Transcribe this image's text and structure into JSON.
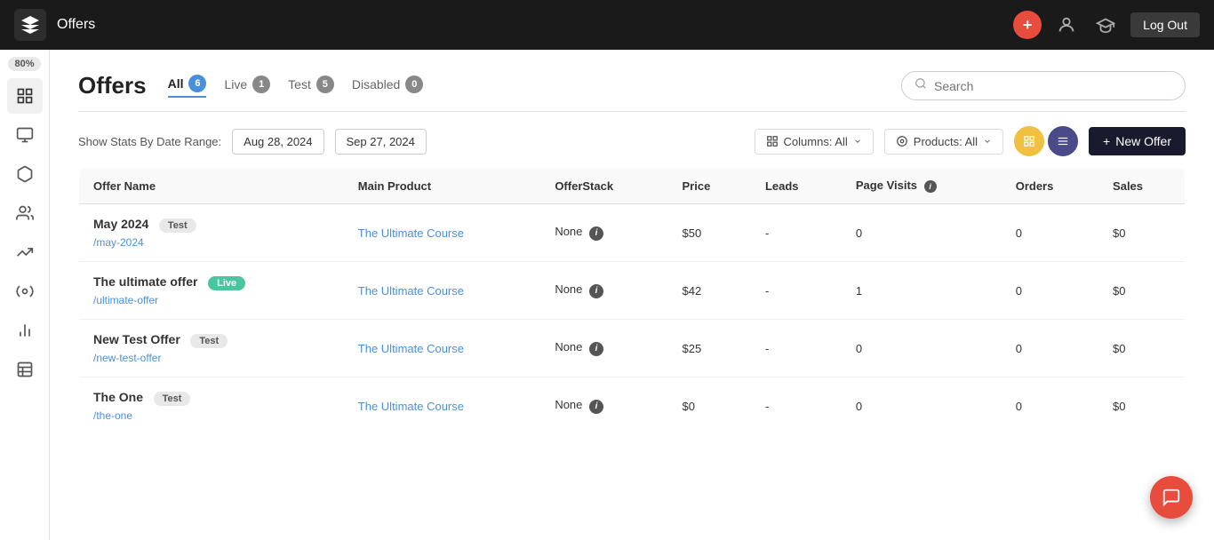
{
  "topnav": {
    "title": "Offers",
    "logout_label": "Log Out",
    "plus_icon": "+",
    "user_icon": "👤",
    "grad_icon": "🎓"
  },
  "sidebar_badge": "80%",
  "tabs": {
    "all": {
      "label": "All",
      "count": "6"
    },
    "live": {
      "label": "Live",
      "count": "1"
    },
    "test": {
      "label": "Test",
      "count": "5"
    },
    "disabled": {
      "label": "Disabled",
      "count": "0"
    }
  },
  "search": {
    "placeholder": "Search"
  },
  "toolbar": {
    "stats_label": "Show Stats By Date Range:",
    "date_start": "Aug 28, 2024",
    "date_end": "Sep 27, 2024",
    "columns_label": "Columns: All",
    "products_label": "Products: All",
    "new_offer_label": "New Offer"
  },
  "table": {
    "headers": [
      "Offer Name",
      "Main Product",
      "OfferStack",
      "Price",
      "Leads",
      "Page Visits",
      "Orders",
      "Sales"
    ],
    "rows": [
      {
        "name": "May 2024",
        "badge": "Test",
        "badge_type": "test",
        "slug": "/may-2024",
        "product": "The Ultimate Course",
        "offerstack": "None",
        "price": "$50",
        "leads": "-",
        "page_visits": "0",
        "orders": "0",
        "sales": "$0"
      },
      {
        "name": "The ultimate offer",
        "badge": "Live",
        "badge_type": "live",
        "slug": "/ultimate-offer",
        "product": "The Ultimate Course",
        "offerstack": "None",
        "price": "$42",
        "leads": "-",
        "page_visits": "1",
        "orders": "0",
        "sales": "$0"
      },
      {
        "name": "New Test Offer",
        "badge": "Test",
        "badge_type": "test",
        "slug": "/new-test-offer",
        "product": "The Ultimate Course",
        "offerstack": "None",
        "price": "$25",
        "leads": "-",
        "page_visits": "0",
        "orders": "0",
        "sales": "$0"
      },
      {
        "name": "The One",
        "badge": "Test",
        "badge_type": "test",
        "slug": "/the-one",
        "product": "The Ultimate Course",
        "offerstack": "None",
        "price": "$0",
        "leads": "-",
        "page_visits": "0",
        "orders": "0",
        "sales": "$0"
      }
    ]
  }
}
